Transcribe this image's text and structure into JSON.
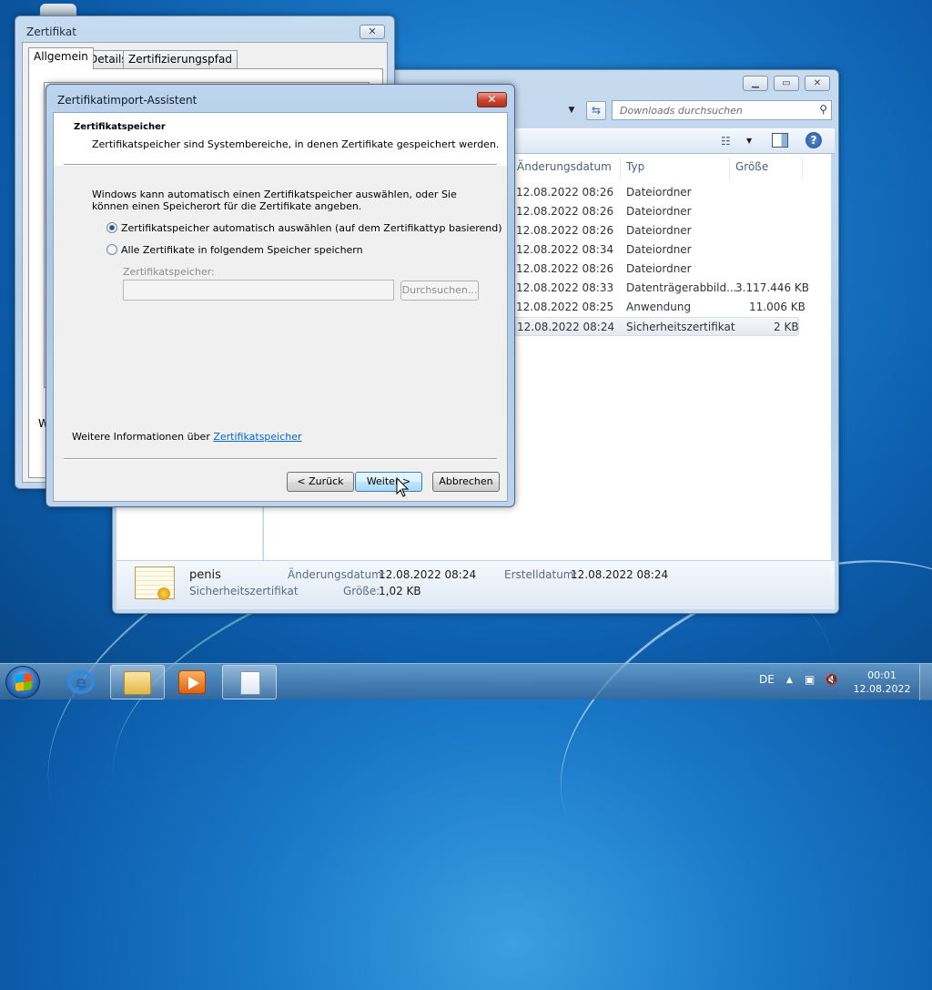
{
  "explorer": {
    "search_placeholder": "Downloads durchsuchen",
    "columns": [
      "Änderungsdatum",
      "Typ",
      "Größe"
    ],
    "rows": [
      {
        "date": "12.08.2022 08:26",
        "type": "Dateiordner",
        "size": ""
      },
      {
        "date": "12.08.2022 08:26",
        "type": "Dateiordner",
        "size": ""
      },
      {
        "date": "12.08.2022 08:26",
        "type": "Dateiordner",
        "size": ""
      },
      {
        "date": "12.08.2022 08:34",
        "type": "Dateiordner",
        "size": ""
      },
      {
        "date": "12.08.2022 08:26",
        "type": "Dateiordner",
        "size": ""
      },
      {
        "date": "12.08.2022 08:33",
        "type": "Datenträgerabbild...",
        "size": "3.117.446 KB"
      },
      {
        "date": "12.08.2022 08:25",
        "type": "Anwendung",
        "size": "11.006 KB"
      },
      {
        "date": "12.08.2022 08:24",
        "type": "Sicherheitszertifikat",
        "size": "2 KB"
      }
    ],
    "details": {
      "name": "penis",
      "type": "Sicherheitszertifikat",
      "modified_label": "Änderungsdatum:",
      "modified_value": "12.08.2022 08:24",
      "created_label": "Erstelldatum:",
      "created_value": "12.08.2022 08:24",
      "size_label": "Größe:",
      "size_value": "1,02 KB"
    }
  },
  "zertifikat": {
    "title": "Zertifikat",
    "tabs": [
      "Allgemein",
      "Details",
      "Zertifizierungspfad"
    ],
    "fragment": "W"
  },
  "wizard": {
    "title": "Zertifikatimport-Assistent",
    "close": "✕",
    "header_title": "Zertifikatspeicher",
    "header_subtitle": "Zertifikatspeicher sind Systembereiche, in denen Zertifikate gespeichert werden.",
    "paragraph": "Windows kann automatisch einen Zertifikatspeicher auswählen, oder Sie können einen Speicherort für die Zertifikate angeben.",
    "option_auto": "Zertifikatspeicher automatisch auswählen (auf dem Zertifikattyp basierend)",
    "option_manual": "Alle Zertifikate in folgendem Speicher speichern",
    "store_label": "Zertifikatspeicher:",
    "browse": "Durchsuchen...",
    "info_prefix": "Weitere Informationen über ",
    "info_link": "Zertifikatspeicher",
    "back": "< Zurück",
    "next": "Weiter >",
    "cancel": "Abbrechen"
  },
  "taskbar": {
    "lang": "DE",
    "time": "00:01",
    "date": "12.08.2022"
  }
}
